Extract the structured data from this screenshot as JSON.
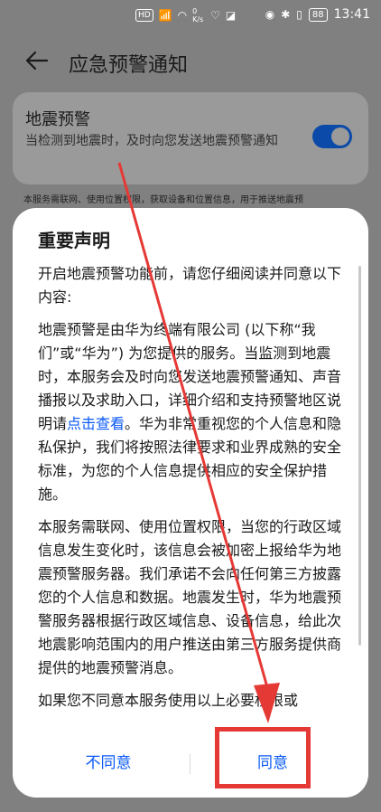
{
  "status_bar": {
    "left_icons": [
      "hd-icon",
      "signal-icon",
      "wifi-icon"
    ],
    "hd_label": "HD",
    "speed": "0 K/s",
    "battery": "88",
    "time": "13:41"
  },
  "header": {
    "title": "应急预警通知"
  },
  "background_card": {
    "title": "地震预警",
    "description": "当检测到地震时，及时向您发送地震预警通知",
    "toggle_on": true,
    "note": "本服务需联网、使用位置权限，获取设备和位置信息，用于推送地震预"
  },
  "dialog": {
    "title": "重要声明",
    "para1": "开启地震预警功能前，请您仔细阅读并同意以下内容:",
    "para2_before_link": "地震预警是由华为终端有限公司 (以下称“我们”或“华为”) 为您提供的服务。当监测到地震时，本服务会及时向您发送地震预警通知、声音播报以及求助入口，详细介绍和支持预警地区说明请",
    "para2_link": "点击查看",
    "para2_after_link": "。华为非常重视您的个人信息和隐私保护，我们将按照法律要求和业界成熟的安全标准，为您的个人信息提供相应的安全保护措施。",
    "para3": "本服务需联网、使用位置权限，当您的行政区域信息发生变化时，该信息会被加密上报给华为地震预警服务器。我们承诺不会向任何第三方披露您的个人信息和数据。地震发生时，华为地震预警服务器根据行政区域信息、设备信息，给此次地震影响范围内的用户推送由第三方服务提供商提供的地震预警消息。",
    "para4": "如果您不同意本服务使用以上必要权限或",
    "disagree_label": "不同意",
    "agree_label": "同意"
  },
  "colors": {
    "accent": "#0a59f7",
    "annotation": "#e53935"
  }
}
